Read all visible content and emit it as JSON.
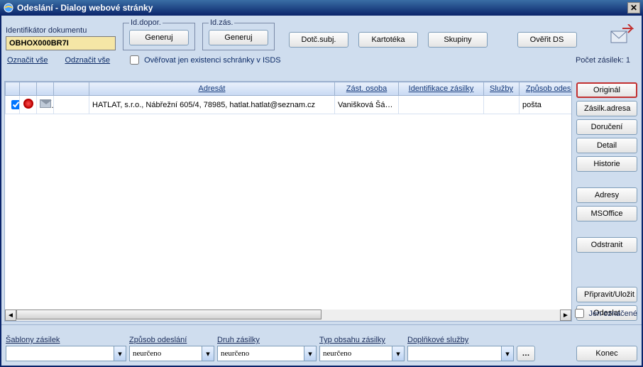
{
  "window": {
    "title": "Odeslání - Dialog webové stránky"
  },
  "top": {
    "doc_id_label": "Identifikátor dokumentu",
    "doc_id_value": "OBHOX000BR7I",
    "id_dopor_legend": "Id.dopor.",
    "id_zas_legend": "Id.zás.",
    "generuj": "Generuj",
    "dotc_subj": "Dotč.subj.",
    "kartoteka": "Kartotéka",
    "skupiny": "Skupiny",
    "overit_ds": "Ověřit DS"
  },
  "links": {
    "oznacit_vse": "Označit vše",
    "odznacit_vse": "Odznačit vše",
    "overovat_isds": "Ověřovat jen existenci schránky v ISDS",
    "pocet_zasilek_label": "Počet zásilek:",
    "pocet_zasilek_value": "1"
  },
  "table": {
    "headers": {
      "adresat": "Adresát",
      "zast_osoba": "Zást. osoba",
      "identifikace": "Identifikace zásilky",
      "sluzby": "Služby",
      "zpusob": "Způsob odeslání"
    },
    "rows": [
      {
        "checked": true,
        "adresat": "HATLAT, s.r.o., Nábřežní 605/4, 78985, hatlat.hatlat@seznam.cz",
        "zast_osoba": "Vanišková Šárka",
        "identifikace": "",
        "sluzby": "",
        "zpusob": "pošta"
      }
    ]
  },
  "side": {
    "original": "Originál",
    "zasilk_adresa": "Zásilk.adresa",
    "doruceni": "Doručení",
    "detail": "Detail",
    "historie": "Historie",
    "adresy": "Adresy",
    "msoffice": "MSOffice",
    "odstranit": "Odstranit",
    "pripravit": "Připravit/Uložit",
    "odeslat": "Odeslat",
    "jen_oznacene": "Jen označené"
  },
  "bottom": {
    "sablony_label": "Šablony zásilek",
    "sablony_value": "",
    "zpusob_label": "Způsob odeslání",
    "zpusob_value": "neurčeno",
    "druh_label": "Druh zásilky",
    "druh_value": "neurčeno",
    "typ_label": "Typ obsahu zásilky",
    "typ_value": "neurčeno",
    "dopl_label": "Doplňkové služby",
    "dopl_value": "",
    "konec": "Konec"
  }
}
